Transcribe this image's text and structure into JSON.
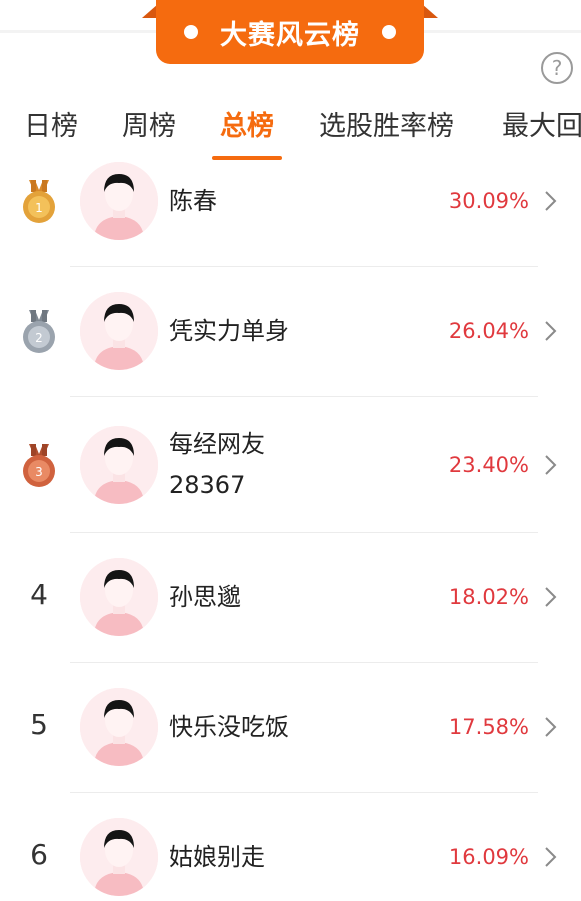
{
  "banner": {
    "title": "大赛风云榜"
  },
  "help_icon": "?",
  "tabs": [
    {
      "label": "日榜"
    },
    {
      "label": "周榜"
    },
    {
      "label": "总榜",
      "active": true
    },
    {
      "label": "选股胜率榜"
    },
    {
      "label": "最大回"
    }
  ],
  "ranking": [
    {
      "rank": "1",
      "medal": "gold",
      "name": "陈春",
      "pct": "30.09%"
    },
    {
      "rank": "2",
      "medal": "silver",
      "name": "凭实力单身",
      "pct": "26.04%"
    },
    {
      "rank": "3",
      "medal": "bronze",
      "name_line1": "每经网友",
      "name_line2": "28367",
      "pct": "23.40%"
    },
    {
      "rank": "4",
      "name": "孙思邈",
      "pct": "18.02%"
    },
    {
      "rank": "5",
      "name": "快乐没吃饭",
      "pct": "17.58%"
    },
    {
      "rank": "6",
      "name": "姑娘别走",
      "pct": "16.09%"
    }
  ],
  "colors": {
    "accent": "#f56b0f",
    "percent": "#e0393e",
    "gold": "#e3a23a",
    "silver": "#9aa3ad",
    "bronze": "#d0623e"
  }
}
